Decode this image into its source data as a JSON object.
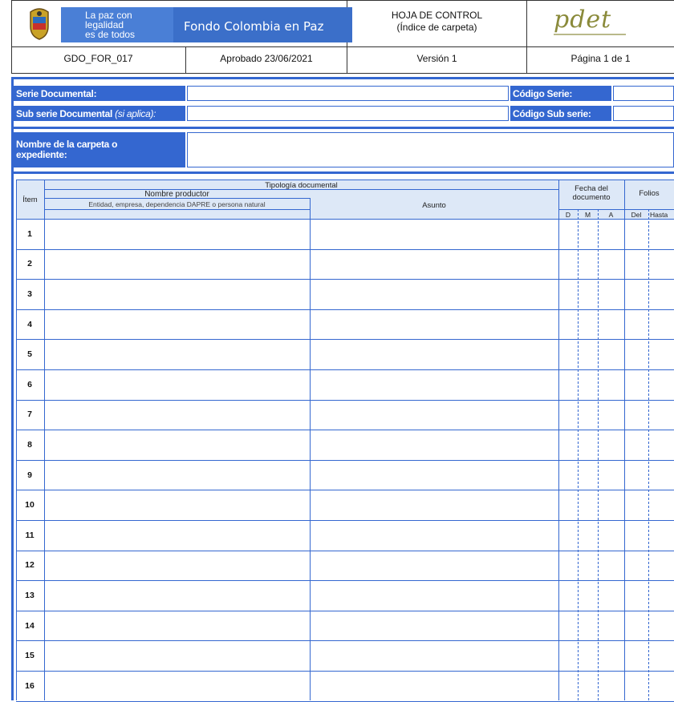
{
  "header": {
    "banner_line1": "La paz con",
    "banner_line2": "legalidad",
    "banner_line3": "es de todos",
    "banner_name": "Fondo Colombia en Paz",
    "title_line1": "HOJA DE CONTROL",
    "title_line2": "(Índice de carpeta)",
    "right_logo_text": "pdet",
    "code": "GDO_FOR_017",
    "approved": "Aprobado 23/06/2021",
    "version": "Versión 1",
    "page": "Página 1 de 1"
  },
  "form": {
    "serie_label": "Serie Documental:",
    "subserie_label": "Sub serie Documental",
    "subserie_hint": "(si aplica):",
    "codigo_serie_label": "Código Serie:",
    "codigo_subserie_label": "Código Sub serie:",
    "carpeta_label_1": "Nombre de la carpeta o",
    "carpeta_label_2": "expediente:"
  },
  "table": {
    "item_header": "Ítem",
    "tipologia_header": "Tipología documental",
    "productor_header": "Nombre productor",
    "productor_sub": "Entidad, empresa, dependencia DAPRE o persona natural",
    "asunto_header": "Asunto",
    "fecha_header_1": "Fecha del",
    "fecha_header_2": "documento",
    "d": "D",
    "m": "M",
    "a": "A",
    "folios_header": "Folios",
    "del": "Del",
    "hasta": "Hasta",
    "rows": [
      "1",
      "2",
      "3",
      "4",
      "5",
      "6",
      "7",
      "8",
      "9",
      "10",
      "11",
      "12",
      "13",
      "14",
      "15",
      "16"
    ]
  }
}
